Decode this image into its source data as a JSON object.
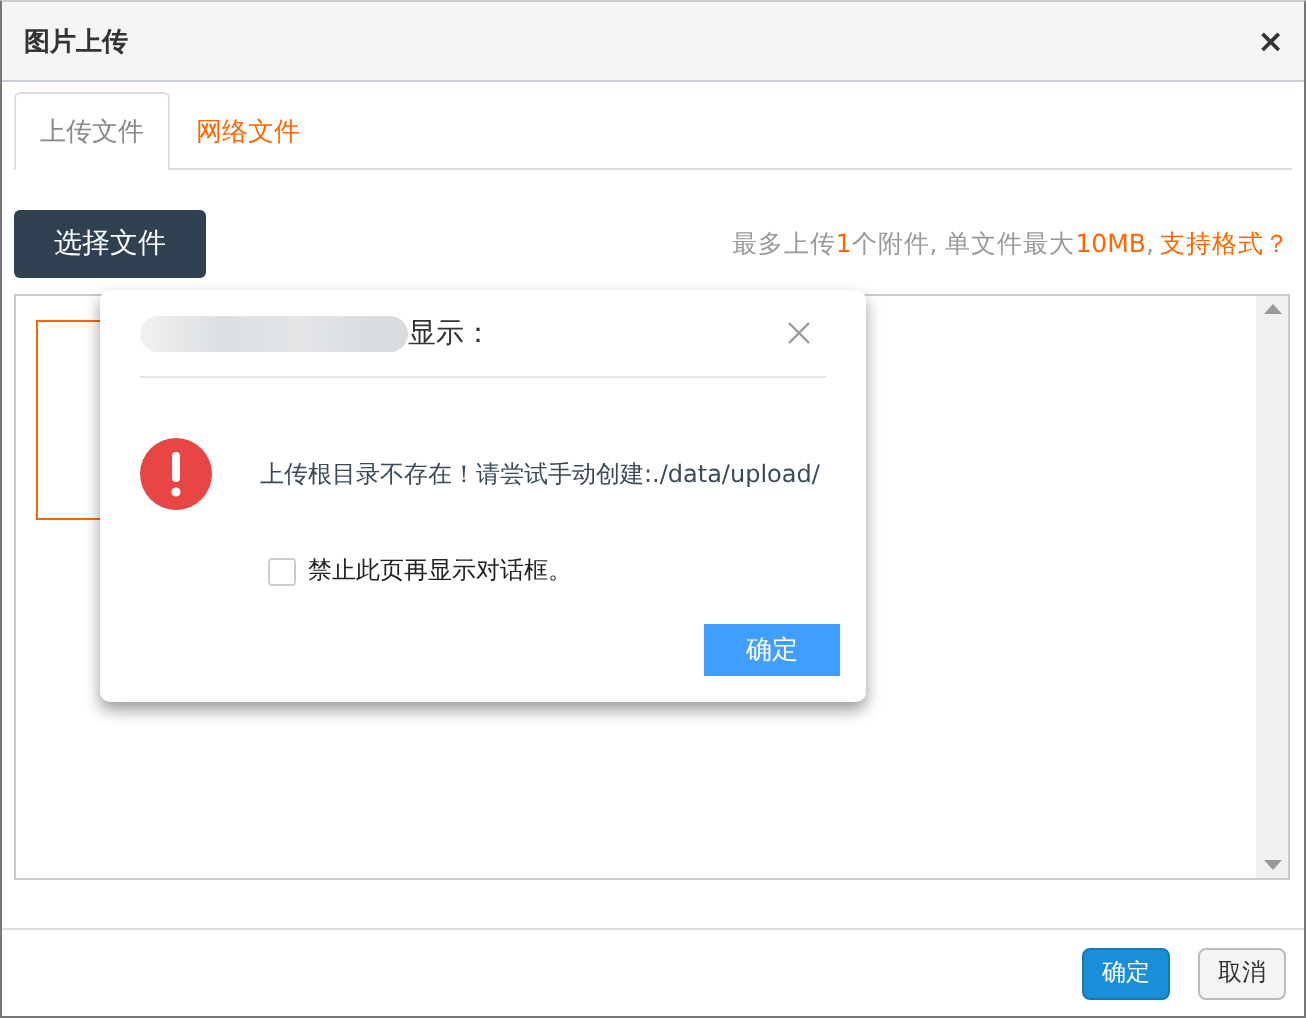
{
  "window": {
    "title": "图片上传",
    "close": "×"
  },
  "tabs": [
    {
      "label": "上传文件",
      "selected": true
    },
    {
      "label": "网络文件",
      "selected": false
    }
  ],
  "toolbar": {
    "button": "选择文件",
    "hint": [
      {
        "text": "最多上传",
        "highlight": false
      },
      {
        "text": "1",
        "highlight": true
      },
      {
        "text": "个附件, 单文件最大",
        "highlight": false
      },
      {
        "text": "10MB",
        "highlight": true
      },
      {
        "text": ",",
        "highlight": false
      }
    ],
    "formats_link": "支持格式？"
  },
  "footer_buttons": [
    {
      "label": "确定",
      "kind": "primary"
    },
    {
      "label": "取消",
      "kind": "default"
    }
  ],
  "alert": {
    "title": "显示：",
    "message": "上传根目录不存在！请尝试手动创建:./data/upload/",
    "checkbox": {
      "label": "禁止此页再显示对话框。",
      "checked": false
    },
    "button": "确定"
  }
}
